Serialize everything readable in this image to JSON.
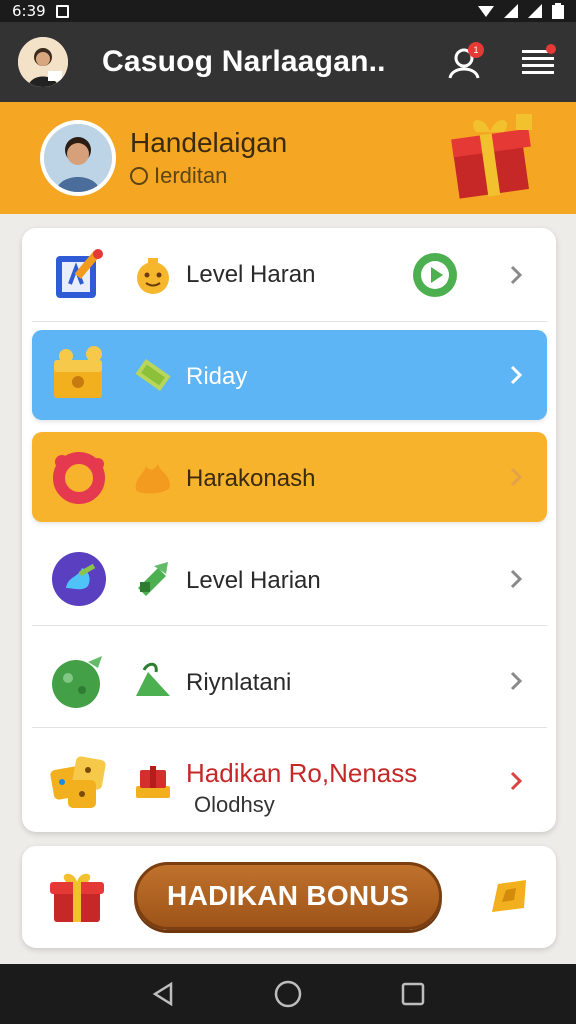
{
  "status_bar": {
    "time": "6:39"
  },
  "header": {
    "title": "Casuog Narlaagan..",
    "notification_badge": "1",
    "icons": [
      "avatar",
      "user-notification-icon",
      "menu-icon"
    ]
  },
  "profile": {
    "name": "Handelaigan",
    "subtitle": "Ierditan"
  },
  "menu": {
    "items": [
      {
        "label": "Level Haran",
        "style": "white",
        "icon": "calendar-icon",
        "small_icon": "coin-face-icon",
        "has_play": true
      },
      {
        "label": "Riday",
        "style": "blue",
        "icon": "treasure-chest-icon",
        "small_icon": "cash-icon",
        "has_play": false
      },
      {
        "label": "Harakonash",
        "style": "orange",
        "icon": "ring-icon",
        "small_icon": "star-blob-icon",
        "has_play": false
      },
      {
        "label": "Level Harian",
        "style": "white",
        "icon": "globe-icon",
        "small_icon": "leaf-gift-icon",
        "has_play": false
      },
      {
        "label": "Riynlatani",
        "style": "white",
        "icon": "green-orb-icon",
        "small_icon": "green-bag-icon",
        "has_play": false
      },
      {
        "label": "Hadikan Ro,Nenass",
        "sublabel": "Olodhsy",
        "style": "white-red",
        "icon": "dice-icon",
        "small_icon": "present-stack-icon",
        "has_play": false
      }
    ]
  },
  "bonus": {
    "button_label": "HADIKAN BONUS"
  },
  "colors": {
    "header_bg": "#333333",
    "banner_bg": "#f5a623",
    "row_blue": "#5db5f5",
    "row_orange": "#f7b32c",
    "accent_red": "#c62828",
    "bonus_button": "#b0652a"
  }
}
